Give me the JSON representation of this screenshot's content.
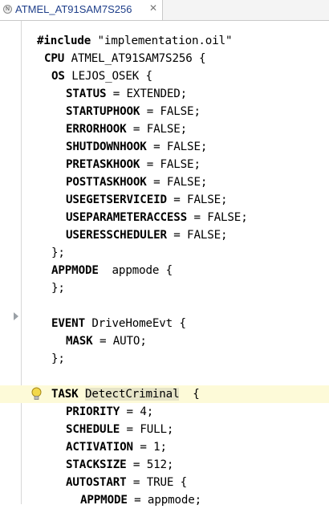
{
  "tab": {
    "title": "ATMEL_AT91SAM7S256",
    "icon": "N",
    "close": "✕"
  },
  "lines": {
    "l1": {
      "a": "#include",
      "b": " \"implementation.oil\""
    },
    "l2": {
      "a": "CPU",
      "b": " ATMEL_AT91SAM7S256 {"
    },
    "l3": {
      "a": "OS",
      "b": " LEJOS_OSEK {"
    },
    "l4": {
      "a": "STATUS",
      "b": " = EXTENDED;"
    },
    "l5": {
      "a": "STARTUPHOOK",
      "b": " = FALSE;"
    },
    "l6": {
      "a": "ERRORHOOK",
      "b": " = FALSE;"
    },
    "l7": {
      "a": "SHUTDOWNHOOK",
      "b": " = FALSE;"
    },
    "l8": {
      "a": "PRETASKHOOK",
      "b": " = FALSE;"
    },
    "l9": {
      "a": "POSTTASKHOOK",
      "b": " = FALSE;"
    },
    "l10": {
      "a": "USEGETSERVICEID",
      "b": " = FALSE;"
    },
    "l11": {
      "a": "USEPARAMETERACCESS",
      "b": " = FALSE;"
    },
    "l12": {
      "a": "USERESSCHEDULER",
      "b": " = FALSE;"
    },
    "l13": {
      "a": "",
      "b": "};"
    },
    "l14": {
      "a": "APPMODE",
      "b": "  appmode {"
    },
    "l15": {
      "a": "",
      "b": "};"
    },
    "l16": {
      "a": "",
      "b": ""
    },
    "l17": {
      "a": "EVENT",
      "b": " DriveHomeEvt {"
    },
    "l18": {
      "a": "MASK",
      "b": " = AUTO;"
    },
    "l19": {
      "a": "",
      "b": "};"
    },
    "l20": {
      "a": "",
      "b": ""
    },
    "l21": {
      "a": "TASK",
      "sp": " ",
      "w": "DetectCriminal",
      "b": "  {"
    },
    "l22": {
      "a": "PRIORITY",
      "b": " = 4;"
    },
    "l23": {
      "a": "SCHEDULE",
      "b": " = FULL;"
    },
    "l24": {
      "a": "ACTIVATION",
      "b": " = 1;"
    },
    "l25": {
      "a": "STACKSIZE",
      "b": " = 512;"
    },
    "l26": {
      "a": "AUTOSTART",
      "b": " = TRUE {"
    },
    "l27": {
      "a": "APPMODE",
      "b": " = appmode;"
    }
  }
}
